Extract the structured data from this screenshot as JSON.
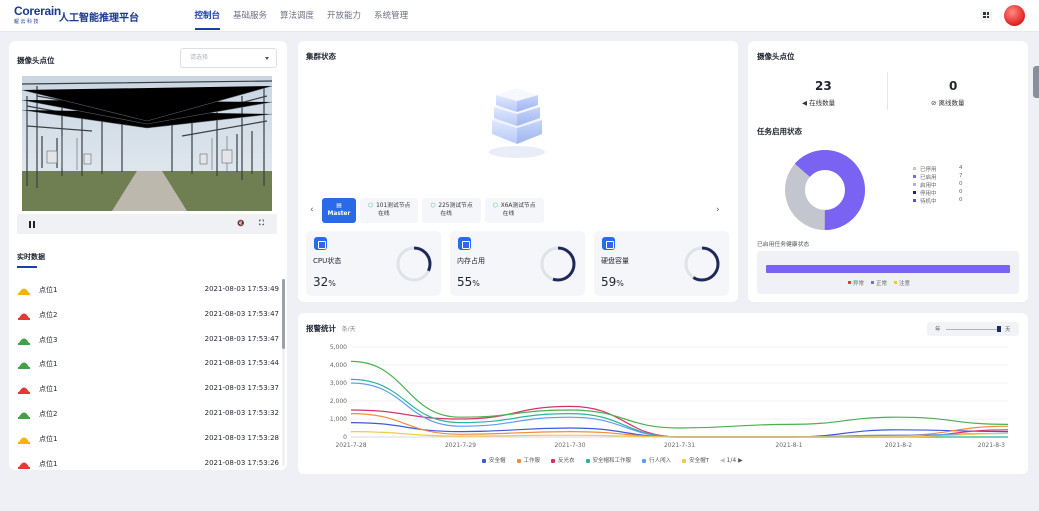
{
  "app": {
    "logo_text": "Corerain",
    "logo_sub": "鲲云科技",
    "title": "人工智能推理平台"
  },
  "nav": [
    {
      "label": "控制台",
      "active": true
    },
    {
      "label": "基础服务",
      "active": false
    },
    {
      "label": "算法调度",
      "active": false
    },
    {
      "label": "开放能力",
      "active": false
    },
    {
      "label": "系统管理",
      "active": false
    }
  ],
  "camera_panel": {
    "title": "摄像头点位",
    "select_placeholder": "请选择"
  },
  "realtime": {
    "tab_label": "实时数据",
    "rows": [
      {
        "name": "点位1",
        "time": "2021-08-03 17:53:49",
        "icon": "worker-icon",
        "color": "#f4b400"
      },
      {
        "name": "点位2",
        "time": "2021-08-03 17:53:47",
        "icon": "hardhat-icon",
        "color": "#e53935"
      },
      {
        "name": "点位3",
        "time": "2021-08-03 17:53:47",
        "icon": "vest-icon",
        "color": "#43a047"
      },
      {
        "name": "点位1",
        "time": "2021-08-03 17:53:44",
        "icon": "person-icon",
        "color": "#43a047"
      },
      {
        "name": "点位1",
        "time": "2021-08-03 17:53:37",
        "icon": "hardhat-icon",
        "color": "#e53935"
      },
      {
        "name": "点位2",
        "time": "2021-08-03 17:53:32",
        "icon": "vest-icon",
        "color": "#43a047"
      },
      {
        "name": "点位1",
        "time": "2021-08-03 17:53:28",
        "icon": "worker-icon",
        "color": "#f4b400"
      },
      {
        "name": "点位1",
        "time": "2021-08-03 17:53:26",
        "icon": "hardhat-icon",
        "color": "#e53935"
      }
    ]
  },
  "cluster": {
    "title": "集群状态",
    "nodes": [
      {
        "name": "Master",
        "status": "",
        "active": true
      },
      {
        "name": "101测试节点",
        "status": "在线",
        "active": false
      },
      {
        "name": "225测试节点",
        "status": "在线",
        "active": false
      },
      {
        "name": "X6A测试节点",
        "status": "在线",
        "active": false
      }
    ],
    "stats": [
      {
        "label": "CPU状态",
        "value": "32",
        "unit": "%",
        "percent": 32
      },
      {
        "label": "内存占用",
        "value": "55",
        "unit": "%",
        "percent": 55
      },
      {
        "label": "硬盘容量",
        "value": "59",
        "unit": "%",
        "percent": 59
      }
    ]
  },
  "camera_summary": {
    "title": "摄像头点位",
    "online_count": "23",
    "online_label": "在线数量",
    "offline_count": "0",
    "offline_label": "离线数量"
  },
  "task_status": {
    "title": "任务启用状态",
    "legend": [
      {
        "label": "已停用",
        "value": "4",
        "color": "#c4c6cf"
      },
      {
        "label": "已启用",
        "value": "7",
        "color": "#7a62f2"
      },
      {
        "label": "启用中",
        "value": "0",
        "color": "#b7a9f7"
      },
      {
        "label": "停用中",
        "value": "0",
        "color": "#1f2a5c"
      },
      {
        "label": "待机中",
        "value": "0",
        "color": "#5a4fcf"
      }
    ],
    "health_title": "已启用任务健康状态",
    "health_legend": [
      {
        "label": "异常",
        "color": "#e53935"
      },
      {
        "label": "正常",
        "color": "#7a62f2"
      },
      {
        "label": "注意",
        "color": "#f4c542"
      }
    ]
  },
  "alarm": {
    "title": "报警统计",
    "unit": "条/天",
    "range_start": "年",
    "range_end": "天",
    "pager": "1/4"
  },
  "chart_data": {
    "type": "line",
    "title": "报警统计",
    "x": [
      "2021-7-28",
      "2021-7-29",
      "2021-7-30",
      "2021-7-31",
      "2021-8-1",
      "2021-8-2",
      "2021-8-3"
    ],
    "ylim": [
      0,
      5000
    ],
    "yticks": [
      0,
      1000,
      2000,
      3000,
      4000,
      5000
    ],
    "series": [
      {
        "name": "安全帽",
        "color": "#3b5bdb",
        "values": [
          800,
          300,
          500,
          0,
          0,
          400,
          300
        ]
      },
      {
        "name": "工作服",
        "color": "#f08c3a",
        "values": [
          1300,
          150,
          300,
          0,
          0,
          100,
          600
        ]
      },
      {
        "name": "反光衣",
        "color": "#d6336c",
        "values": [
          1500,
          1000,
          1700,
          0,
          0,
          0,
          400
        ]
      },
      {
        "name": "安全帽和工作服",
        "color": "#2bb59a",
        "values": [
          3200,
          800,
          1300,
          0,
          0,
          0,
          0
        ]
      },
      {
        "name": "行人闯入",
        "color": "#5c9ded",
        "values": [
          3000,
          600,
          1100,
          0,
          0,
          100,
          200
        ]
      },
      {
        "name": "安全帽T",
        "color": "#f2c94c",
        "values": [
          300,
          50,
          100,
          0,
          0,
          0,
          200
        ]
      },
      {
        "name": "",
        "color": "#4caf50",
        "values": [
          4200,
          1100,
          1500,
          500,
          700,
          1100,
          700
        ]
      }
    ]
  }
}
